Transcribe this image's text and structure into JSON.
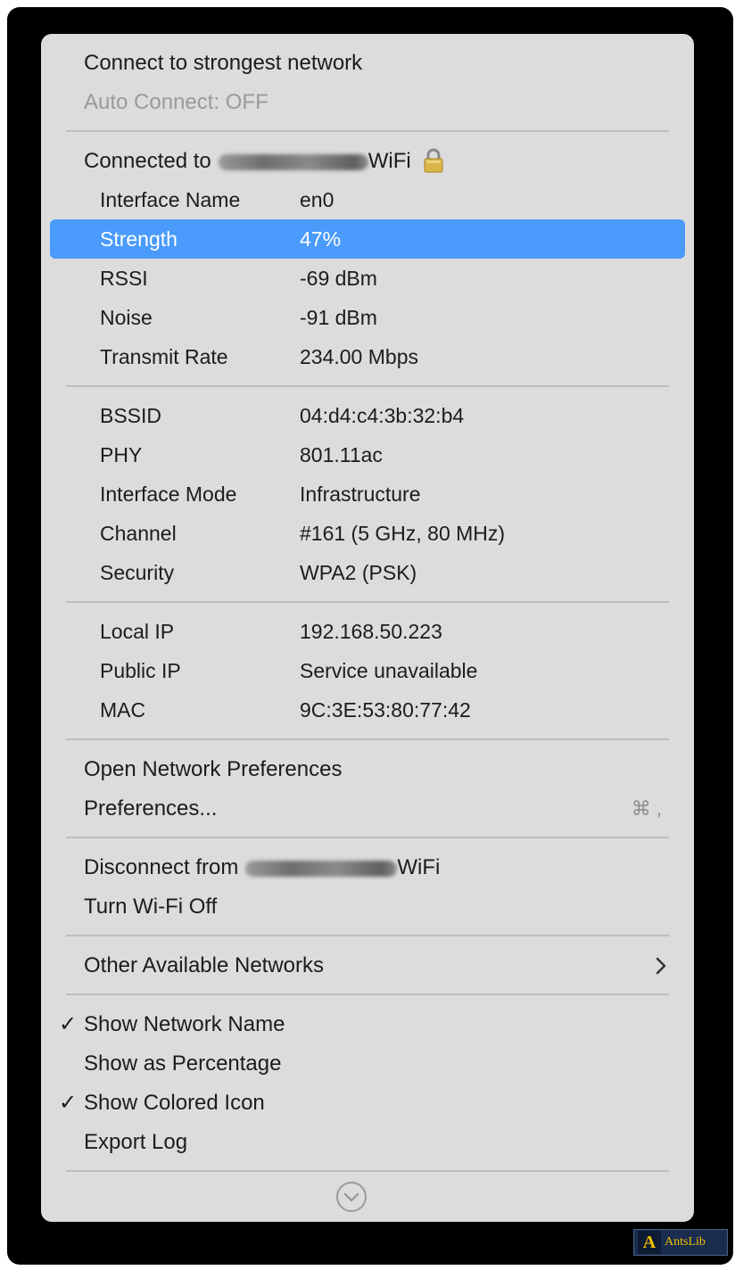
{
  "menu": {
    "connect_strongest": "Connect to strongest network",
    "auto_connect": "Auto Connect: OFF",
    "connected_prefix": "Connected to",
    "network_suffix": "WiFi",
    "info": [
      {
        "key": "Interface Name",
        "value": "en0"
      },
      {
        "key": "Strength",
        "value": "47%"
      },
      {
        "key": "RSSI",
        "value": "-69 dBm"
      },
      {
        "key": "Noise",
        "value": "-91 dBm"
      },
      {
        "key": "Transmit Rate",
        "value": "234.00 Mbps"
      }
    ],
    "radio": [
      {
        "key": "BSSID",
        "value": "04:d4:c4:3b:32:b4"
      },
      {
        "key": "PHY",
        "value": "801.11ac"
      },
      {
        "key": "Interface Mode",
        "value": "Infrastructure"
      },
      {
        "key": "Channel",
        "value": "#161 (5 GHz, 80 MHz)"
      },
      {
        "key": "Security",
        "value": "WPA2 (PSK)"
      }
    ],
    "addresses": [
      {
        "key": "Local IP",
        "value": "192.168.50.223"
      },
      {
        "key": "Public IP",
        "value": "Service unavailable"
      },
      {
        "key": "MAC",
        "value": "9C:3E:53:80:77:42"
      }
    ],
    "open_network_prefs": "Open Network Preferences",
    "preferences": "Preferences...",
    "preferences_shortcut": "⌘ ,",
    "disconnect_prefix": "Disconnect from",
    "turn_wifi_off": "Turn Wi-Fi Off",
    "other_networks": "Other Available Networks",
    "show_network_name": "Show Network Name",
    "show_as_percentage": "Show as Percentage",
    "show_colored_icon": "Show Colored Icon",
    "export_log": "Export Log",
    "checkmark": "✓",
    "highlighted_row": "Strength",
    "highlight_color": "#4a9bfb"
  },
  "watermark": {
    "text": "AntsLib"
  }
}
